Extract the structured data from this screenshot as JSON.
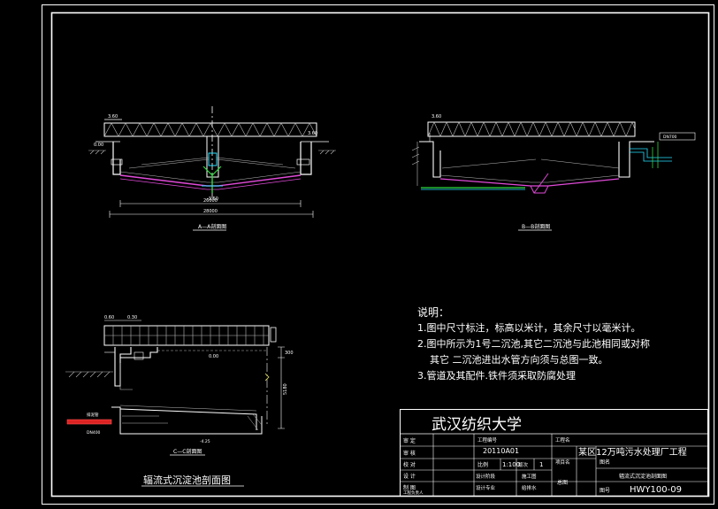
{
  "drawing": {
    "section_a_label": "A—A剖面图",
    "section_b_label": "B—B剖面图",
    "section_c_label": "C—C剖面图",
    "main_title": "辐流式沉淀池剖面图"
  },
  "dims": {
    "a_top_left": "3.60",
    "a_top_right": "3.60",
    "a_left_level": "0.00",
    "a_bottom_mid": "-3.50",
    "a_span_total": "28000",
    "a_span_inner": "26000",
    "b_top": "3.60",
    "b_right_pipe": "DN700",
    "c_top_left": "0.60",
    "c_top_right": "0.30",
    "c_level": "0.00",
    "c_right_dim": "300",
    "c_depth_dim": "5180",
    "c_pipe_label": "排泥管",
    "c_pipe_size": "DN400",
    "c_bottom_level": "-4.25"
  },
  "notes": {
    "heading": "说明：",
    "line1": "1.图中尺寸标注，标高以米计，其余尺寸以毫米计。",
    "line2a": "2.图中所示为1号二沉池,其它二沉池与此池相同或对称",
    "line2b": "其它  二沉池进出水管方向须与总图一致。",
    "line3": "3.管道及其配件.铁件须采取防腐处理"
  },
  "title_block": {
    "school": "武汉纺织大学",
    "label_audit": "审  定",
    "label_review": "审  核",
    "label_check": "校  对",
    "label_design": "设  计",
    "label_drawing": "制  图",
    "label_project_lead": "工程负责人",
    "label_project_no": "工程编号",
    "project_no": "20110A01",
    "label_project_name": "工程名",
    "project_name": "某区12万吨污水处理厂工程",
    "label_scale": "比例",
    "scale": "1:100",
    "label_version": "版次",
    "version": "1",
    "label_design_stage": "设计阶段",
    "design_stage": "施工图",
    "label_design_major": "设计专业",
    "design_major": "给排水",
    "label_item": "项目名",
    "item": "总图",
    "label_drawing_name": "图名",
    "drawing_name": "辐流式沉淀池剖面图",
    "label_drawing_no": "图号",
    "drawing_no": "HWY100-09"
  }
}
